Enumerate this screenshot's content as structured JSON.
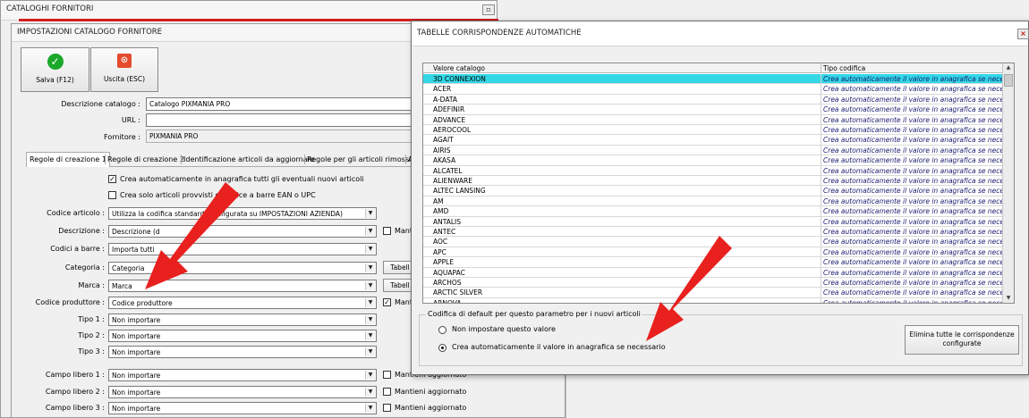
{
  "bg_window": {
    "title": "CATALOGHI FORNITORI",
    "close": "▫"
  },
  "settings": {
    "title": "IMPOSTAZIONI CATALOGO FORNITORE",
    "save_label": "Salva (F12)",
    "exit_label": "Uscita (ESC)",
    "desc_label": "Descrizione catalogo :",
    "desc_value": "Catalogo PIXMANIA PRO",
    "url_label": "URL :",
    "url_value": "",
    "supplier_label": "Fornitore :",
    "supplier_value": "PIXMANIA PRO",
    "tabs": [
      "Regole di creazione 1",
      "Regole di creazione 2",
      "Identificazione articoli da aggiornare",
      "Regole per gli articoli rimossi",
      "A"
    ],
    "chk1_label": "Crea automaticamente in anagrafica tutti gli eventuali nuovi articoli",
    "chk2_label": "Crea solo articoli provvisti di codice a barre EAN o UPC",
    "fields": [
      {
        "label": "Codice articolo :",
        "value": "Utilizza la codifica standard (configurata su IMPOSTAZIONI AZIENDA)"
      },
      {
        "label": "Descrizione :",
        "value": "Descrizione (d"
      },
      {
        "label": "Codici a barre :",
        "value": "Importa tutti"
      },
      {
        "label": "Categoria :",
        "value": "Categoria"
      },
      {
        "label": "Marca :",
        "value": "Marca"
      },
      {
        "label": "Codice produttore :",
        "value": "Codice produttore"
      },
      {
        "label": "Tipo 1 :",
        "value": "Non importare"
      },
      {
        "label": "Tipo 2 :",
        "value": "Non importare"
      },
      {
        "label": "Tipo 3 :",
        "value": "Non importare"
      },
      {
        "label": "Campo libero 1 :",
        "value": "Non importare"
      },
      {
        "label": "Campo libero 2 :",
        "value": "Non importare"
      },
      {
        "label": "Campo libero 3 :",
        "value": "Non importare"
      }
    ],
    "maint_desc": "Mantie",
    "maint_prod": "Manti",
    "tab_cat": "Tabell",
    "tab_marca": "Tabell",
    "maint_full": "Mantieni aggiornato"
  },
  "dialog": {
    "title": "TABELLE CORRISPONDENZE AUTOMATICHE",
    "col1": "Valore catalogo",
    "col2": "Tipo codifica",
    "rows": [
      "3D CONNEXION",
      "ACER",
      "A-DATA",
      "ADEFINIR",
      "ADVANCE",
      "AEROCOOL",
      "AGAIT",
      "AIRIS",
      "AKASA",
      "ALCATEL",
      "ALIENWARE",
      "ALTEC LANSING",
      "AM",
      "AMD",
      "ANTALIS",
      "ANTEC",
      "AOC",
      "APC",
      "APPLE",
      "AQUAPAC",
      "ARCHOS",
      "ARCTIC SILVER",
      "ARNOVA"
    ],
    "type_value": "Crea automaticamente il valore in anagrafica se necessario",
    "group_label": "Codifica di default per questo parametro per i nuovi articoli",
    "radio1": "Non impostare questo valore",
    "radio2": "Crea automaticamente il valore in anagrafica se necessario",
    "delete_btn_l1": "Elimina tutte le corrispondenze",
    "delete_btn_l2": "configurate"
  },
  "colors": {
    "selected_row": "#33d7e6",
    "arrow": "#e8211e"
  }
}
